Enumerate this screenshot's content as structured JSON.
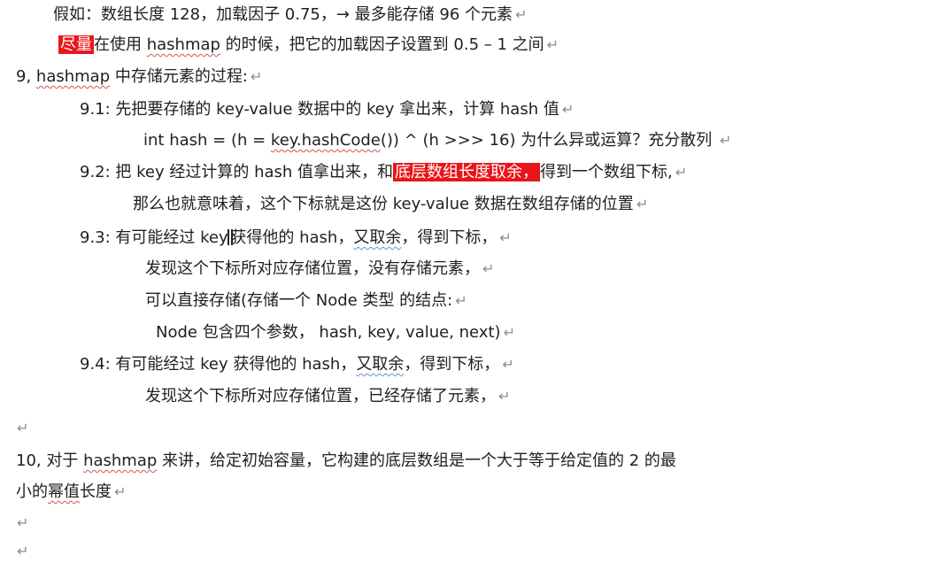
{
  "paragraph_mark": "↵",
  "lines": {
    "l1": {
      "text": "假如：数组长度 128，加载因子 0.75，→  最多能存储  96 个元素"
    },
    "l2": {
      "highlight": "尽量",
      "text_a": "在使用 ",
      "word": "hashmap",
      "text_b": " 的时候，把它的加载因子设置到  0.5 – 1 之间"
    },
    "l3": {
      "text_a": "9, ",
      "word": "hashmap",
      "text_b": " 中存储元素的过程:"
    },
    "l4": {
      "text": "9.1:  先把要存储的 key-value 数据中的 key 拿出来，计算 hash 值"
    },
    "l5": {
      "text_a": "int hash = (h = ",
      "word": "key.hashCode",
      "text_b": "()) ^ (h >>> 16)      为什么异或运算？充分散列  "
    },
    "l6": {
      "text_a": "9.2:  把 key 经过计算的 hash 值拿出来，和",
      "highlight": "底层数组长度取余，",
      "text_b": "得到一个数组下标,"
    },
    "l7": {
      "text": "那么也就意味着，这个下标就是这份 key-value 数据在数组存储的位置"
    },
    "l8": {
      "text_a": "9.3:  有可能经过 key ",
      "text_b": "获得他的 hash，",
      "word": "又取余",
      "text_c": "，得到下标，"
    },
    "l9": {
      "text": "发现这个下标所对应存储位置，没有存储元素，"
    },
    "l10": {
      "text": "可以直接存储(存储一个 Node 类型  的结点:"
    },
    "l11": {
      "text": "Node 包含四个参数，   hash, key, value, next)"
    },
    "l12": {
      "text_a": "9.4:  有可能经过 key 获得他的 hash，",
      "word": "又取余",
      "text_b": "，得到下标，"
    },
    "l13": {
      "text": "发现这个下标所对应存储位置，已经存储了元素，"
    },
    "l15": {
      "text_a": "10, 对于 ",
      "word": "hashmap",
      "text_b": " 来讲，给定初始容量，它构建的底层数组是一个大于等于给定值的 2 的最"
    },
    "l16": {
      "text_a": "小的",
      "word": "幂值",
      "text_b": "长度"
    }
  }
}
